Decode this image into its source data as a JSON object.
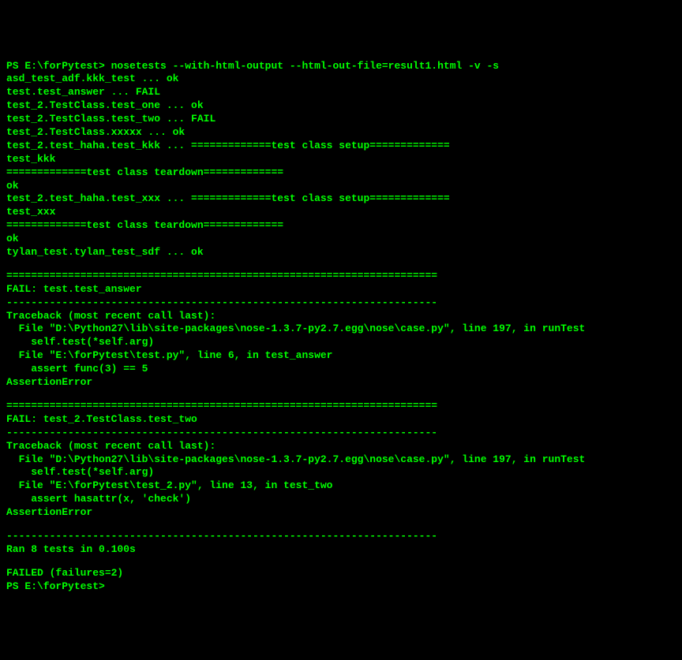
{
  "terminal": {
    "prompt1": "PS E:\\forPytest> ",
    "command": "nosetests --with-html-output --html-out-file=result1.html -v -s",
    "lines": [
      "asd_test_adf.kkk_test ... ok",
      "test.test_answer ... FAIL",
      "test_2.TestClass.test_one ... ok",
      "test_2.TestClass.test_two ... FAIL",
      "test_2.TestClass.xxxxx ... ok",
      "test_2.test_haha.test_kkk ... =============test class setup=============",
      "test_kkk",
      "=============test class teardown=============",
      "ok",
      "test_2.test_haha.test_xxx ... =============test class setup=============",
      "test_xxx",
      "=============test class teardown=============",
      "ok",
      "tylan_test.tylan_test_sdf ... ok",
      "",
      "======================================================================",
      "FAIL: test.test_answer",
      "----------------------------------------------------------------------",
      "Traceback (most recent call last):",
      "  File \"D:\\Python27\\lib\\site-packages\\nose-1.3.7-py2.7.egg\\nose\\case.py\", line 197, in runTest",
      "    self.test(*self.arg)",
      "  File \"E:\\forPytest\\test.py\", line 6, in test_answer",
      "    assert func(3) == 5",
      "AssertionError",
      "",
      "======================================================================",
      "FAIL: test_2.TestClass.test_two",
      "----------------------------------------------------------------------",
      "Traceback (most recent call last):",
      "  File \"D:\\Python27\\lib\\site-packages\\nose-1.3.7-py2.7.egg\\nose\\case.py\", line 197, in runTest",
      "    self.test(*self.arg)",
      "  File \"E:\\forPytest\\test_2.py\", line 13, in test_two",
      "    assert hasattr(x, 'check')",
      "AssertionError",
      "",
      "----------------------------------------------------------------------",
      "Ran 8 tests in 0.100s",
      "",
      "FAILED (failures=2)"
    ],
    "prompt2": "PS E:\\forPytest> "
  }
}
